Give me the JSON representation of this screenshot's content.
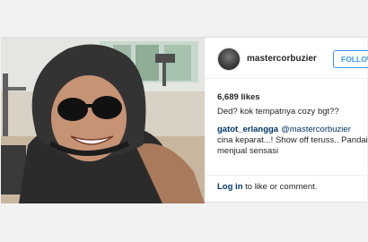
{
  "post": {
    "username": "mastercorbuzier",
    "follow_label": "FOLLOW",
    "likes": "6,689 likes",
    "comments": [
      {
        "user": "",
        "text": "Ded? kok tempatnya cozy bgt??"
      },
      {
        "user": "gatot_erlangga",
        "mention": "@mastercorbuzier",
        "text": " cina keparat...! Show off teruss.. Pandai menjual sensasi"
      }
    ],
    "login_link": "Log in",
    "login_rest": " to like or comment."
  },
  "colors": {
    "follow_blue": "#3897f0",
    "link_navy": "#003569",
    "text": "#262626"
  },
  "icons": {
    "avatar": "profile-photo"
  }
}
